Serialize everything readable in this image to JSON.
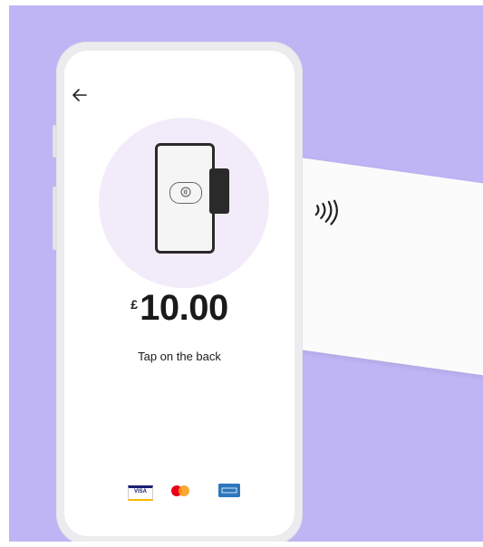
{
  "screen": {
    "back_icon": "arrow-left-icon",
    "amount": {
      "currency_symbol": "£",
      "value": "10.00"
    },
    "status_text": "Tap on the back",
    "payment_brands": [
      "Visa",
      "Mastercard",
      "American Express"
    ],
    "brand_labels": {
      "visa": "VISA"
    }
  },
  "colors": {
    "background": "#bfb4f4",
    "accent_circle": "#f2ecfa",
    "text": "#1a1a1a"
  }
}
